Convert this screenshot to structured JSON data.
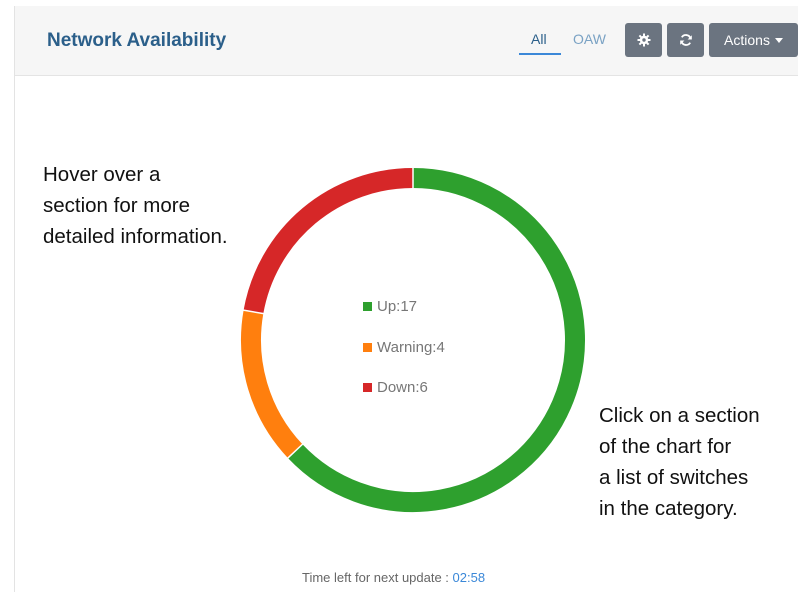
{
  "header": {
    "title": "Network Availability",
    "tabs": [
      {
        "label": "All",
        "active": true
      },
      {
        "label": "OAW",
        "active": false
      }
    ],
    "buttons": {
      "settings_icon": "gear-icon",
      "refresh_icon": "refresh-icon",
      "actions_label": "Actions"
    }
  },
  "annotations": {
    "hover": [
      "Hover over a",
      "section for more",
      "detailed information."
    ],
    "click": [
      "Click on a section",
      "of the chart for",
      "a list of switches",
      "in the category."
    ]
  },
  "chart_data": {
    "type": "pie",
    "categories": [
      "Up",
      "Warning",
      "Down"
    ],
    "values": [
      17,
      4,
      6
    ],
    "colors": [
      "#2ea02e",
      "#ff7f0e",
      "#d62728"
    ],
    "legend": [
      {
        "label": "Up:17",
        "color": "#2ea02e"
      },
      {
        "label": "Warning:4",
        "color": "#ff7f0e"
      },
      {
        "label": "Down:6",
        "color": "#d62728"
      }
    ]
  },
  "footer": {
    "label": "Time left for next update : ",
    "timer": "02:58"
  }
}
